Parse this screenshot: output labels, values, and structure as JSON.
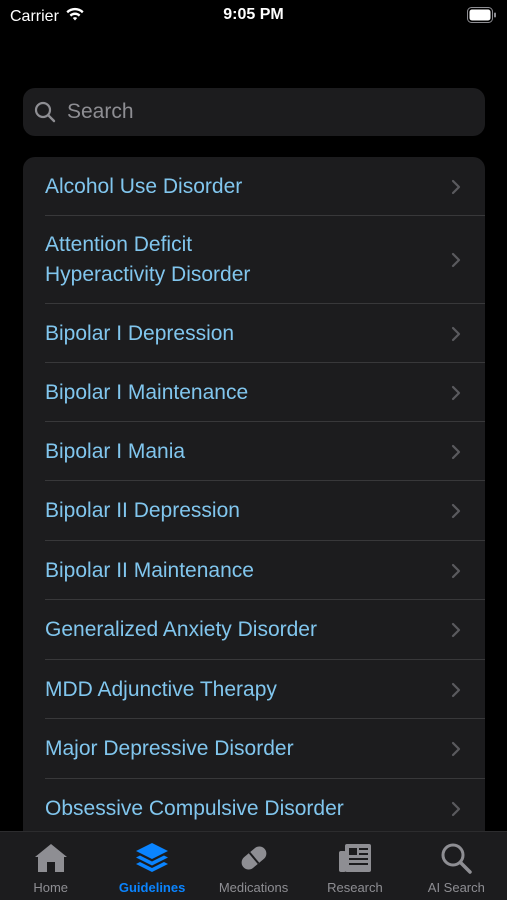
{
  "status_bar": {
    "carrier": "Carrier",
    "time": "9:05 PM"
  },
  "search": {
    "placeholder": "Search"
  },
  "guidelines": [
    {
      "label": "Alcohol Use Disorder"
    },
    {
      "label": "Attention Deficit Hyperactivity Disorder",
      "line1": "Attention Deficit",
      "line2": "Hyperactivity Disorder"
    },
    {
      "label": "Bipolar I Depression"
    },
    {
      "label": "Bipolar I Maintenance"
    },
    {
      "label": "Bipolar I Mania"
    },
    {
      "label": "Bipolar II Depression"
    },
    {
      "label": "Bipolar II Maintenance"
    },
    {
      "label": "Generalized Anxiety Disorder"
    },
    {
      "label": "MDD Adjunctive Therapy"
    },
    {
      "label": "Major Depressive Disorder"
    },
    {
      "label": "Obsessive Compulsive Disorder"
    }
  ],
  "tabbar": [
    {
      "label": "Home",
      "icon": "house-icon",
      "active": false
    },
    {
      "label": "Guidelines",
      "icon": "layers-icon",
      "active": true
    },
    {
      "label": "Medications",
      "icon": "pill-icon",
      "active": false
    },
    {
      "label": "Research",
      "icon": "newspaper-icon",
      "active": false
    },
    {
      "label": "AI Search",
      "icon": "search-icon",
      "active": false
    }
  ],
  "colors": {
    "accent": "#0a84ff",
    "link": "#81c6ee",
    "cell": "#1c1c1e"
  }
}
